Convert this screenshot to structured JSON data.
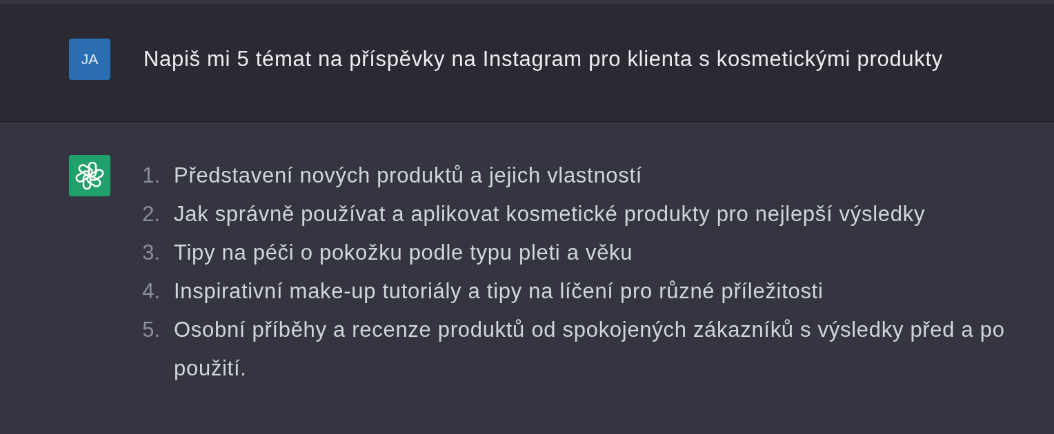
{
  "conversation": [
    {
      "kind": "user",
      "avatar": "JA",
      "text": "Napiš mi 5 témat na příspěvky na Instagram pro klienta s kosmetickými produkty"
    },
    {
      "kind": "assistant",
      "items": [
        {
          "number": "1.",
          "text": "Představení nových produktů a jejich vlastností"
        },
        {
          "number": "2.",
          "text": "Jak správně používat a aplikovat kosmetické produkty pro nejlepší výsledky"
        },
        {
          "number": "3.",
          "text": "Tipy na péči o pokožku podle typu pleti a věku"
        },
        {
          "number": "4.",
          "text": "Inspirativní make-up tutoriály a tipy na líčení pro různé příležitosti"
        },
        {
          "number": "5.",
          "text": "Osobní příběhy a recenze produktů od spokojených zákazníků s výsledky před a po použití."
        }
      ]
    }
  ]
}
